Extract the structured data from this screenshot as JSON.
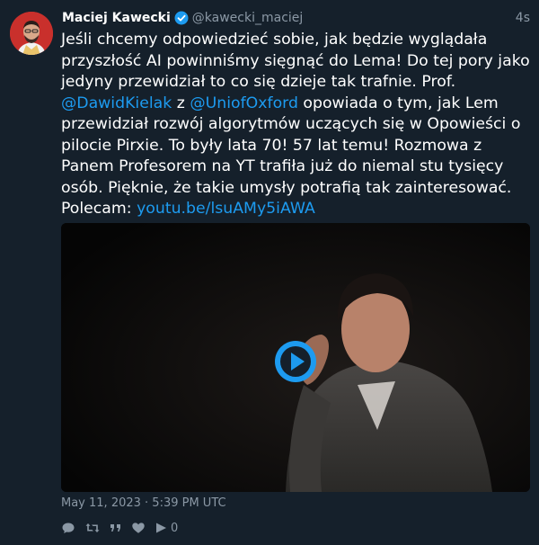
{
  "author": {
    "name": "Maciej Kawecki",
    "handle": "@kawecki_maciej",
    "time_ago": "4s"
  },
  "tweet": {
    "text_1": "Jeśli chcemy odpowiedzieć sobie, jak będzie wyglądała przyszłość AI powinniśmy sięgnąć do Lema! Do tej pory jako jedyny przewidział to co się dzieje tak trafnie. Prof.",
    "mention_1": "@DawidKielak",
    "text_2": " z ",
    "mention_2": "@UniofOxford",
    "text_3": " opowiada o tym, jak Lem przewidział rozwój algorytmów uczących się w Opowieści o pilocie Pirxie. To były lata 70! 57 lat temu! Rozmowa z Panem Profesorem na YT trafiła już do niemal stu tysięcy osób. Pięknie, że takie umysły potrafią tak zainteresować. Polecam:",
    "link": "youtu.be/lsuAMy5iAWA"
  },
  "timestamp": "May 11, 2023 · 5:39 PM UTC",
  "actions": {
    "play_count": "0"
  },
  "colors": {
    "background": "#15202b",
    "link": "#1d9bf0",
    "muted": "#8b98a5",
    "avatar_bg": "#c9302c"
  },
  "icons": [
    "verified-badge-icon",
    "play-button-icon",
    "reply-icon",
    "retweet-icon",
    "quote-icon",
    "like-icon",
    "view-count-icon"
  ]
}
